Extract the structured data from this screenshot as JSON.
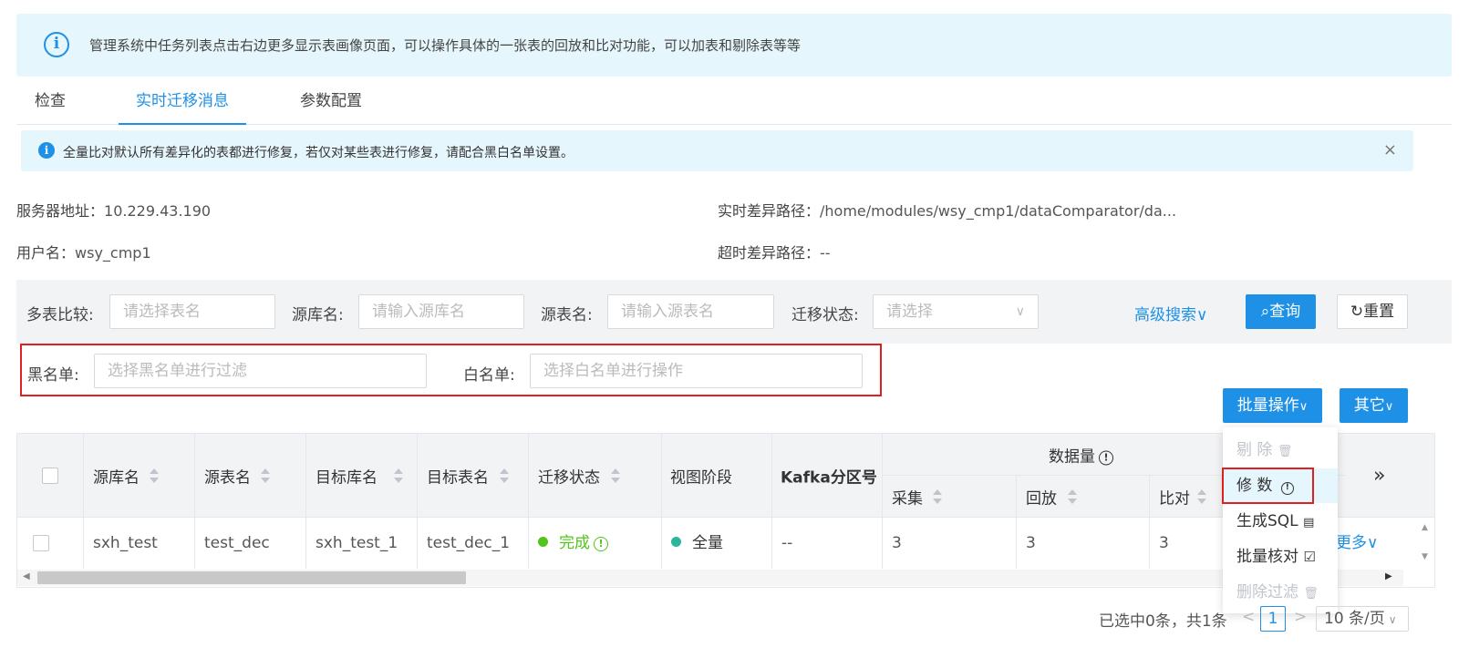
{
  "banner": {
    "text": "管理系统中任务列表点击右边更多显示表画像页面，可以操作具体的一张表的回放和比对功能，可以加表和剔除表等等"
  },
  "tabs": [
    "检查",
    "实时迁移消息",
    "参数配置"
  ],
  "alert": {
    "text": "全量比对默认所有差异化的表都进行修复，若仅对某些表进行修复，请配合黑白名单设置。",
    "close": "×"
  },
  "meta": {
    "server_label": "服务器地址：",
    "server_value": "10.229.43.190",
    "user_label": "用户名：",
    "user_value": "wsy_cmp1",
    "realtime_label": "实时差异路径：",
    "realtime_value": "/home/modules/wsy_cmp1/dataComparator/da...",
    "timeout_label": "超时差异路径：",
    "timeout_value": "--"
  },
  "search": {
    "multi_label": "多表比较:",
    "multi_placeholder": "请选择表名",
    "srcdb_label": "源库名:",
    "srcdb_placeholder": "请输入源库名",
    "srctable_label": "源表名:",
    "srctable_placeholder": "请输入源表名",
    "status_label": "迁移状态:",
    "status_placeholder": "请选择",
    "advanced": "高级搜索∨",
    "query": "查询",
    "reset": "重置",
    "blacklist_label": "黑名单:",
    "blacklist_placeholder": "选择黑名单进行过滤",
    "whitelist_label": "白名单:",
    "whitelist_placeholder": "选择白名单进行操作"
  },
  "toolbar": {
    "batch": "批量操作",
    "other": "其它"
  },
  "table": {
    "headers": {
      "src_db": "源库名",
      "src_table": "源表名",
      "tgt_db": "目标库名",
      "tgt_table": "目标表名",
      "status": "迁移状态",
      "view_stage": "视图阶段",
      "kafka": "Kafka分区号",
      "data_volume": "数据量",
      "collect": "采集",
      "replay": "回放",
      "compare": "比对",
      "expand": "»"
    },
    "rows": [
      {
        "src_db": "sxh_test",
        "src_table": "test_dec",
        "tgt_db": "sxh_test_1",
        "tgt_table": "test_dec_1",
        "status": "完成",
        "view_stage": "全量",
        "kafka": "--",
        "collect": "3",
        "replay": "3",
        "compare": "3",
        "more": "更多∨"
      }
    ]
  },
  "dropdown": {
    "items": [
      "剔 除",
      "修 数",
      "生成SQL",
      "批量核对",
      "删除过滤"
    ]
  },
  "pager": {
    "summary": "已选中0条，共1条",
    "prev": "<",
    "page": "1",
    "next": ">",
    "size": "10 条/页"
  },
  "colors": {
    "primary": "#1e90e6",
    "success": "#52c41a",
    "highlight": "#e02020"
  }
}
